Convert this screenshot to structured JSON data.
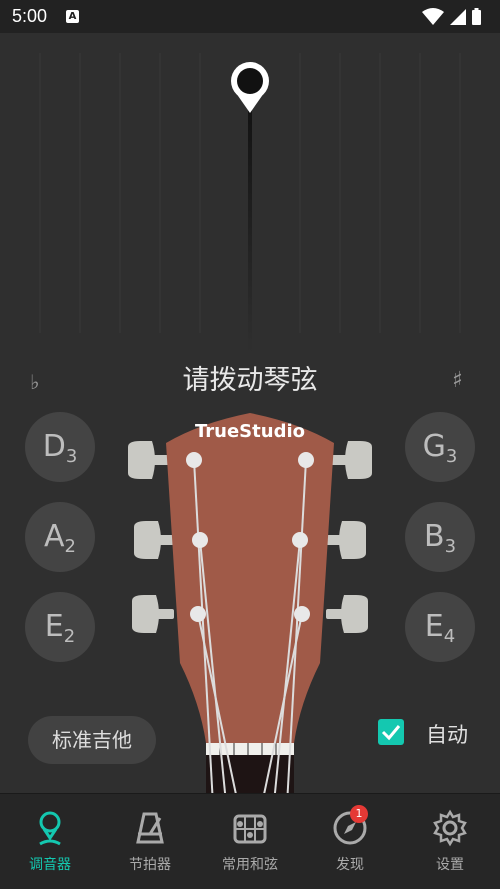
{
  "status_bar": {
    "time": "5:00",
    "notification_glyph": "A"
  },
  "tuner": {
    "prompt": "请拨动琴弦",
    "flat_symbol": "♭",
    "sharp_symbol": "♯",
    "brand": "TrueStudio",
    "notes_left": [
      {
        "letter": "D",
        "octave": "3"
      },
      {
        "letter": "A",
        "octave": "2"
      },
      {
        "letter": "E",
        "octave": "2"
      }
    ],
    "notes_right": [
      {
        "letter": "G",
        "octave": "3"
      },
      {
        "letter": "B",
        "octave": "3"
      },
      {
        "letter": "E",
        "octave": "4"
      }
    ],
    "tuning_button": "标准吉他",
    "auto_label": "自动",
    "auto_checked": true,
    "accent_color": "#14c8b0",
    "headstock_color": "#a05a48"
  },
  "nav": {
    "items": [
      {
        "label": "调音器",
        "icon": "tuner-icon",
        "active": true
      },
      {
        "label": "节拍器",
        "icon": "metronome-icon",
        "active": false
      },
      {
        "label": "常用和弦",
        "icon": "chord-icon",
        "active": false
      },
      {
        "label": "发现",
        "icon": "compass-icon",
        "active": false,
        "badge": "1"
      },
      {
        "label": "设置",
        "icon": "gear-icon",
        "active": false
      }
    ]
  }
}
